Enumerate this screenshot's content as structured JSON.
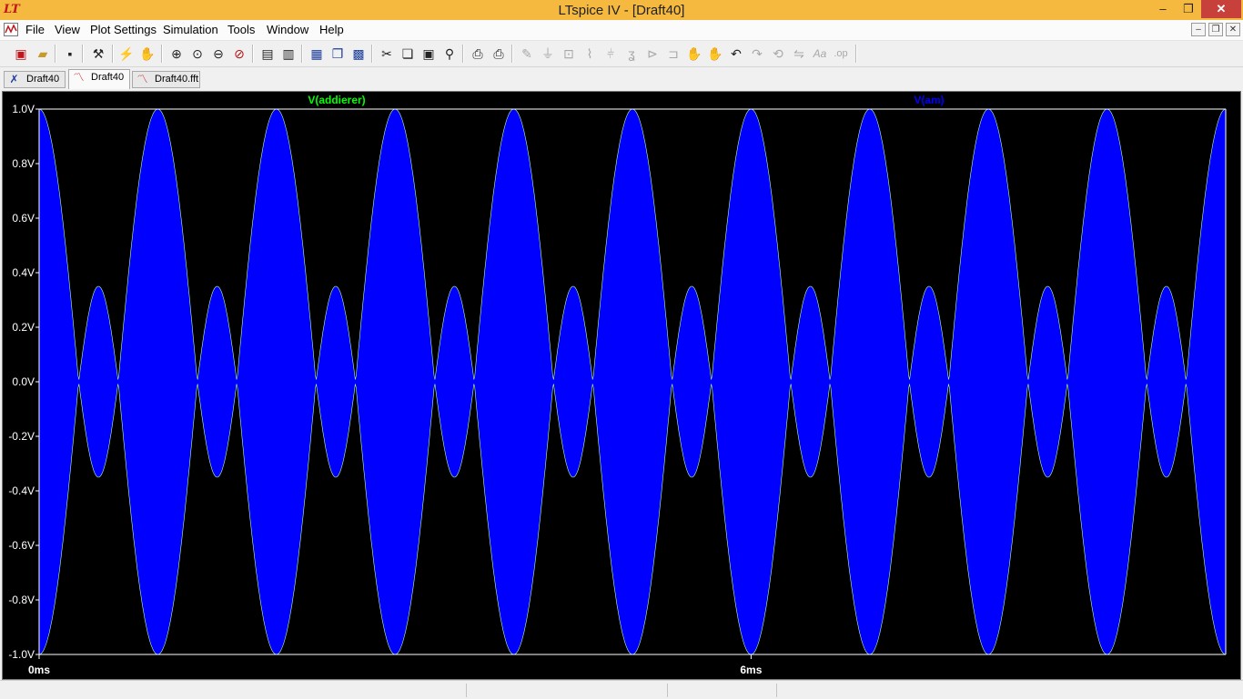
{
  "window": {
    "title": "LTspice IV - [Draft40]",
    "logo": "LT",
    "minimize_glyph": "–",
    "restore_glyph": "❐",
    "close_glyph": "✕"
  },
  "menu": {
    "items": [
      "File",
      "View",
      "Plot Settings",
      "Simulation",
      "Tools",
      "Window",
      "Help"
    ],
    "doc_controls": [
      "–",
      "❐",
      "✕"
    ]
  },
  "toolbar": {
    "icons": [
      "new-schematic-icon",
      "open-icon",
      "save-icon",
      "control-panel-icon",
      "run-icon",
      "halt-icon",
      "zoom-in-icon",
      "zoom-full-icon",
      "zoom-out-icon",
      "zoom-cancel-icon",
      "autorange-icon",
      "manual-limits-icon",
      "tile-horizontal-icon",
      "cascade-icon",
      "tile-icon",
      "cut-icon",
      "copy-icon",
      "paste-icon",
      "find-icon",
      "print-preview-icon",
      "print-icon",
      "wire-icon",
      "ground-icon",
      "label-net-icon",
      "resistor-icon",
      "capacitor-icon",
      "inductor-icon",
      "diode-icon",
      "component-icon",
      "move-icon",
      "drag-icon",
      "undo-icon",
      "redo-icon",
      "rotate-icon",
      "mirror-icon",
      "text-icon",
      "spice-directive-icon"
    ]
  },
  "tabs": [
    {
      "label": "Draft40",
      "icon": "schematic-tab-icon",
      "active": false
    },
    {
      "label": "Draft40",
      "icon": "waveform-tab-icon",
      "active": true
    },
    {
      "label": "Draft40.fft",
      "icon": "fft-tab-icon",
      "active": false
    }
  ],
  "plot": {
    "background": "#000000",
    "trace_colors": {
      "addierer": "#00ff00",
      "am": "#0000ff"
    }
  },
  "chart_data": {
    "type": "line",
    "series": [
      {
        "name": "V(addierer)",
        "color": "#00ff00"
      },
      {
        "name": "V(am)",
        "color": "#0000ff"
      }
    ],
    "ylim": [
      -1.0,
      1.0
    ],
    "yticks": [
      "1.0V",
      "0.8V",
      "0.6V",
      "0.4V",
      "0.2V",
      "0.0V",
      "-0.2V",
      "-0.4V",
      "-0.6V",
      "-0.8V",
      "-1.0V"
    ],
    "xticks": [
      "0ms",
      "6ms"
    ],
    "xlim_ms": [
      0,
      10
    ],
    "envelope": {
      "description": "dense carrier between +/- envelope",
      "amplitude_major": 1.0,
      "amplitude_minor": 0.35,
      "lobe_period_ms": 1.0
    },
    "grid": false
  }
}
